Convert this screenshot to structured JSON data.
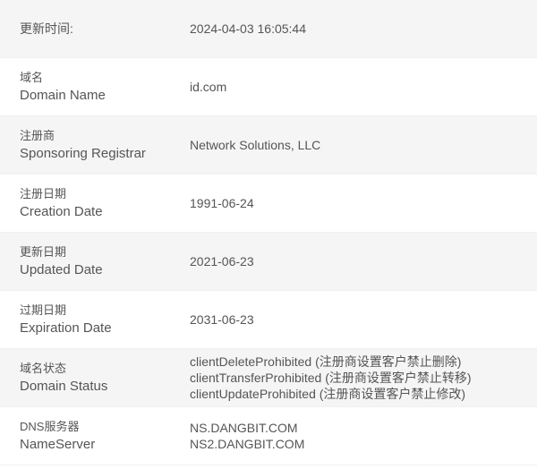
{
  "rows": [
    {
      "cn": "更新时间:",
      "en": "",
      "values": [
        "2024-04-03 16:05:44"
      ]
    },
    {
      "cn": "域名",
      "en": "Domain Name",
      "values": [
        "id.com"
      ]
    },
    {
      "cn": "注册商",
      "en": "Sponsoring Registrar",
      "values": [
        "Network Solutions, LLC"
      ]
    },
    {
      "cn": "注册日期",
      "en": "Creation Date",
      "values": [
        "1991-06-24"
      ]
    },
    {
      "cn": "更新日期",
      "en": "Updated Date",
      "values": [
        "2021-06-23"
      ]
    },
    {
      "cn": "过期日期",
      "en": "Expiration Date",
      "values": [
        "2031-06-23"
      ]
    },
    {
      "cn": "域名状态",
      "en": "Domain Status",
      "values": [
        "clientDeleteProhibited (注册商设置客户禁止删除)",
        "clientTransferProhibited (注册商设置客户禁止转移)",
        "clientUpdateProhibited (注册商设置客户禁止修改)"
      ]
    },
    {
      "cn": "DNS服务器",
      "en": "NameServer",
      "values": [
        "NS.DANGBIT.COM",
        "NS2.DANGBIT.COM"
      ]
    }
  ]
}
